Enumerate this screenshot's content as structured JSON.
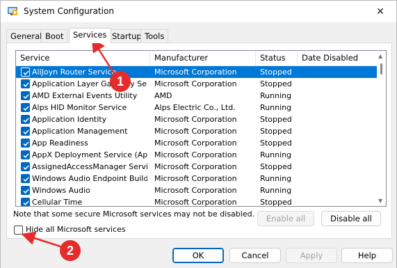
{
  "window": {
    "title": "System Configuration",
    "close_glyph": "✕",
    "icon": "system-config-icon"
  },
  "tabs": [
    {
      "label": "General",
      "active": false
    },
    {
      "label": "Boot",
      "active": false
    },
    {
      "label": "Services",
      "active": true
    },
    {
      "label": "Startup",
      "active": false
    },
    {
      "label": "Tools",
      "active": false
    }
  ],
  "columns": {
    "service": "Service",
    "manufacturer": "Manufacturer",
    "status": "Status",
    "date_disabled": "Date Disabled"
  },
  "services": [
    {
      "name": "AllJoyn Router Service",
      "manufacturer": "Microsoft Corporation",
      "status": "Stopped",
      "checked": true,
      "selected": true
    },
    {
      "name": "Application Layer Gateway Service",
      "manufacturer": "Microsoft Corporation",
      "status": "Stopped",
      "checked": true,
      "selected": false
    },
    {
      "name": "AMD External Events Utility",
      "manufacturer": "AMD",
      "status": "Running",
      "checked": true,
      "selected": false
    },
    {
      "name": "Alps HID Monitor Service",
      "manufacturer": "Alps Electric Co., Ltd.",
      "status": "Running",
      "checked": true,
      "selected": false
    },
    {
      "name": "Application Identity",
      "manufacturer": "Microsoft Corporation",
      "status": "Stopped",
      "checked": true,
      "selected": false
    },
    {
      "name": "Application Management",
      "manufacturer": "Microsoft Corporation",
      "status": "Stopped",
      "checked": true,
      "selected": false
    },
    {
      "name": "App Readiness",
      "manufacturer": "Microsoft Corporation",
      "status": "Stopped",
      "checked": true,
      "selected": false
    },
    {
      "name": "AppX Deployment Service (AppX...",
      "manufacturer": "Microsoft Corporation",
      "status": "Running",
      "checked": true,
      "selected": false
    },
    {
      "name": "AssignedAccessManager Service",
      "manufacturer": "Microsoft Corporation",
      "status": "Stopped",
      "checked": true,
      "selected": false
    },
    {
      "name": "Windows Audio Endpoint Builder",
      "manufacturer": "Microsoft Corporation",
      "status": "Running",
      "checked": true,
      "selected": false
    },
    {
      "name": "Windows Audio",
      "manufacturer": "Microsoft Corporation",
      "status": "Running",
      "checked": true,
      "selected": false
    },
    {
      "name": "Cellular Time",
      "manufacturer": "Microsoft Corporation",
      "status": "Stopped",
      "checked": true,
      "selected": false
    }
  ],
  "note": "Note that some secure Microsoft services may not be disabled.",
  "buttons": {
    "enable_all": "Enable all",
    "disable_all": "Disable all",
    "ok": "OK",
    "cancel": "Cancel",
    "apply": "Apply",
    "help": "Help"
  },
  "hide_ms": {
    "label": "Hide all Microsoft services",
    "checked": false
  },
  "callouts": [
    "1",
    "2"
  ],
  "colors": {
    "accent": "#0078d7",
    "callout": "#e52b2b"
  }
}
